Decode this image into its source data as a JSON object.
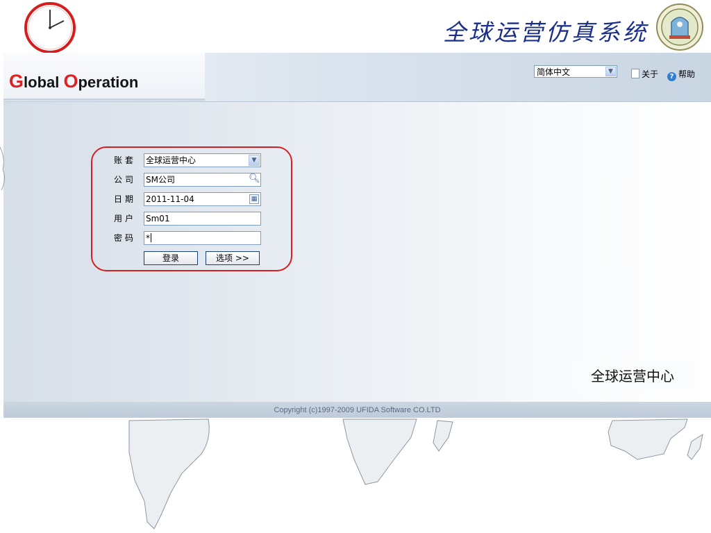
{
  "slide": {
    "system_title": "全球运营仿真系统"
  },
  "header": {
    "brand_first_initial": "G",
    "brand_first_rest": "lobal ",
    "brand_second_initial": "O",
    "brand_second_rest": "peration",
    "language": "简体中文",
    "about_label": "关于",
    "help_label": "帮助"
  },
  "login": {
    "fields": [
      {
        "label": "账套",
        "value": "全球运营中心"
      },
      {
        "label": "公司",
        "value": "SM公司"
      },
      {
        "label": "日期",
        "value": "2011-11-04"
      },
      {
        "label": "用户",
        "value": "Sm01"
      },
      {
        "label": "密码",
        "value": "*"
      }
    ],
    "login_button": "登录",
    "options_button": "选项 >>"
  },
  "center_label": "全球运营中心",
  "footer": {
    "copyright": "Copyright  (c)1997-2009 UFIDA Software CO.LTD"
  },
  "colors": {
    "accent_red": "#e02121",
    "title_blue": "#1a2f8a",
    "highlight_ring": "#d42020"
  }
}
